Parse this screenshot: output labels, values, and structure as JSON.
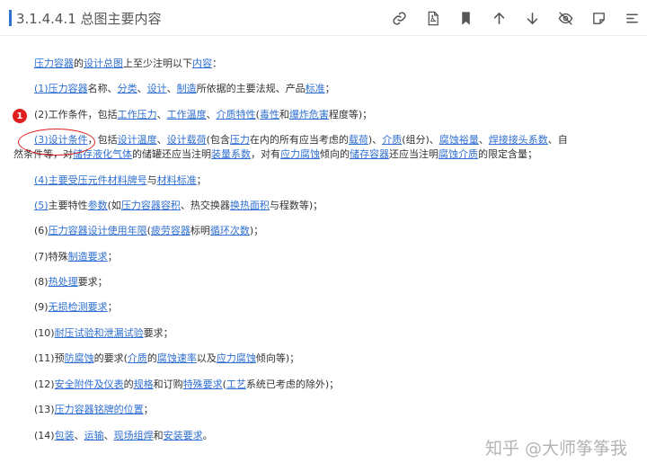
{
  "header": {
    "title": "3.1.4.4.1 总图主要内容"
  },
  "toolbar": {
    "icons": [
      "link-icon",
      "pdf-icon",
      "bookmark-icon",
      "arrow-up-icon",
      "arrow-down-icon",
      "hide-icon",
      "note-icon",
      "more-icon"
    ]
  },
  "annotation": {
    "marker": "1"
  },
  "lines": [
    [
      {
        "t": "压力容器",
        "l": 1
      },
      {
        "t": "的"
      },
      {
        "t": "设计总图",
        "l": 1
      },
      {
        "t": "上至少注明以下"
      },
      {
        "t": "内容",
        "l": 1
      },
      {
        "t": "："
      }
    ],
    [
      {
        "t": "(1)",
        "l": 1
      },
      {
        "t": "压力容器",
        "l": 1
      },
      {
        "t": "名称、"
      },
      {
        "t": "分类",
        "l": 1
      },
      {
        "t": "、"
      },
      {
        "t": "设计",
        "l": 1
      },
      {
        "t": "、"
      },
      {
        "t": "制造",
        "l": 1
      },
      {
        "t": "所依据的主要法规、产品"
      },
      {
        "t": "标准",
        "l": 1
      },
      {
        "t": "；"
      }
    ],
    [
      {
        "t": "(2)"
      },
      {
        "t": "工作条件，包括"
      },
      {
        "t": "工作压力",
        "l": 1
      },
      {
        "t": "、"
      },
      {
        "t": "工作温度",
        "l": 1
      },
      {
        "t": "、"
      },
      {
        "t": "介质特性",
        "l": 1
      },
      {
        "t": "("
      },
      {
        "t": "毒性",
        "l": 1
      },
      {
        "t": "和"
      },
      {
        "t": "爆炸危害",
        "l": 1
      },
      {
        "t": "程度等)；"
      }
    ],
    [
      {
        "t": "(3)设计条件",
        "l": 1
      },
      {
        "t": "，包括"
      },
      {
        "t": "设计温度",
        "l": 1
      },
      {
        "t": "、"
      },
      {
        "t": "设计载荷",
        "l": 1
      },
      {
        "t": "(包含"
      },
      {
        "t": "压力",
        "l": 1
      },
      {
        "t": "在内的所有应当考虑的"
      },
      {
        "t": "载荷",
        "l": 1
      },
      {
        "t": ")、"
      },
      {
        "t": "介质",
        "l": 1
      },
      {
        "t": "(组分)、"
      },
      {
        "t": "腐蚀裕量",
        "l": 1
      },
      {
        "t": "、"
      },
      {
        "t": "焊接接头系数",
        "l": 1
      },
      {
        "t": "、自"
      }
    ],
    [
      {
        "t": "然条件等，对"
      },
      {
        "t": "储存液化气体",
        "l": 1
      },
      {
        "t": "的储罐还应当注明"
      },
      {
        "t": "装量系数",
        "l": 1
      },
      {
        "t": "，对有"
      },
      {
        "t": "应力腐蚀",
        "l": 1
      },
      {
        "t": "倾向的"
      },
      {
        "t": "储存容器",
        "l": 1
      },
      {
        "t": "还应当注明"
      },
      {
        "t": "腐蚀介质",
        "l": 1
      },
      {
        "t": "的限定含量；"
      }
    ],
    [
      {
        "t": "(4)",
        "l": 1
      },
      {
        "t": "主要受压元件材料牌号",
        "l": 1
      },
      {
        "t": "与"
      },
      {
        "t": "材料标准",
        "l": 1
      },
      {
        "t": "；"
      }
    ],
    [
      {
        "t": "(5)",
        "l": 1
      },
      {
        "t": "主要特性"
      },
      {
        "t": "参数",
        "l": 1
      },
      {
        "t": "(如"
      },
      {
        "t": "压力容器容积",
        "l": 1
      },
      {
        "t": "、热交换器"
      },
      {
        "t": "换热面积",
        "l": 1
      },
      {
        "t": "与程数等)；"
      }
    ],
    [
      {
        "t": "(6)"
      },
      {
        "t": "压力容器设计使用年限",
        "l": 1
      },
      {
        "t": "("
      },
      {
        "t": "疲劳容器",
        "l": 1
      },
      {
        "t": "标明"
      },
      {
        "t": "循环次数",
        "l": 1
      },
      {
        "t": ")；"
      }
    ],
    [
      {
        "t": "(7)特殊"
      },
      {
        "t": "制造要求",
        "l": 1
      },
      {
        "t": "；"
      }
    ],
    [
      {
        "t": "(8)"
      },
      {
        "t": "热处理",
        "l": 1
      },
      {
        "t": "要求；"
      }
    ],
    [
      {
        "t": "(9)"
      },
      {
        "t": "无损检测要求",
        "l": 1
      },
      {
        "t": "；"
      }
    ],
    [
      {
        "t": "(10)"
      },
      {
        "t": "耐压试验和泄漏试验",
        "l": 1
      },
      {
        "t": "要求；"
      }
    ],
    [
      {
        "t": "(11)预"
      },
      {
        "t": "防腐蚀",
        "l": 1
      },
      {
        "t": "的要求("
      },
      {
        "t": "介质",
        "l": 1
      },
      {
        "t": "的"
      },
      {
        "t": "腐蚀速率",
        "l": 1
      },
      {
        "t": "以及"
      },
      {
        "t": "应力腐蚀",
        "l": 1
      },
      {
        "t": "倾向等)；"
      }
    ],
    [
      {
        "t": "(12)"
      },
      {
        "t": "安全附件及仪表",
        "l": 1
      },
      {
        "t": "的"
      },
      {
        "t": "规格",
        "l": 1
      },
      {
        "t": "和订购"
      },
      {
        "t": "特殊要求",
        "l": 1
      },
      {
        "t": "("
      },
      {
        "t": "工艺",
        "l": 1
      },
      {
        "t": "系统已考虑的除外)；"
      }
    ],
    [
      {
        "t": "(13)"
      },
      {
        "t": "压力容器铭牌的位置",
        "l": 1
      },
      {
        "t": "；"
      }
    ],
    [
      {
        "t": "(14)"
      },
      {
        "t": "包装",
        "l": 1
      },
      {
        "t": "、"
      },
      {
        "t": "运输",
        "l": 1
      },
      {
        "t": "、"
      },
      {
        "t": "现场组焊",
        "l": 1
      },
      {
        "t": "和"
      },
      {
        "t": "安装要求",
        "l": 1
      },
      {
        "t": "。"
      }
    ]
  ],
  "watermark": "知乎 @大师筝筝我",
  "colors": {
    "link": "#2f6fd1",
    "accent": "#2f6fd1",
    "annotation": "#e02020",
    "text": "#333333"
  }
}
